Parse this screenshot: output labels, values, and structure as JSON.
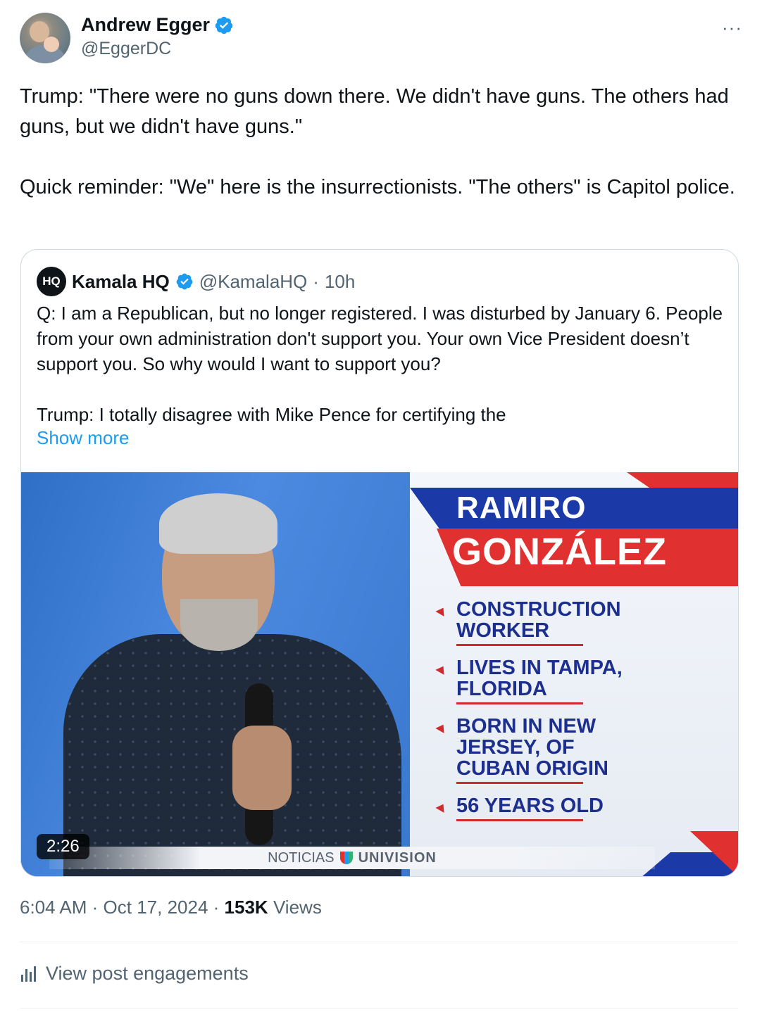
{
  "author": {
    "display_name": "Andrew Egger",
    "handle": "@EggerDC",
    "verified": true
  },
  "more_menu": "···",
  "tweet": {
    "text": "Trump: \"There were no guns down there. We didn't have guns. The others had guns, but we didn't have guns.\"\n\nQuick reminder: \"We\" here is the insurrectionists. \"The others\" is Capitol police."
  },
  "quote": {
    "logo_text": "HQ",
    "display_name": "Kamala HQ",
    "handle": "@KamalaHQ",
    "separator": "·",
    "time": "10h",
    "text": "Q: I am a Republican, but no longer registered. I was disturbed by January 6. People from your own administration don't support you. Your own Vice President doesn’t support you. So why would I want to support you?\n\nTrump: I totally disagree with Mike Pence for certifying the",
    "show_more": "Show more",
    "video": {
      "duration": "2:26",
      "overlay_first_name": "RAMIRO",
      "overlay_last_name": "GONZÁLEZ",
      "facts": [
        "CONSTRUCTION WORKER",
        "LIVES IN TAMPA, FLORIDA",
        "BORN IN NEW JERSEY, OF CUBAN ORIGIN",
        "56 YEARS OLD"
      ],
      "ticker_left": "NOTICIAS",
      "ticker_right": "UNIVISION"
    }
  },
  "meta": {
    "time": "6:04 AM",
    "date": "Oct 17, 2024",
    "views_count": "153K",
    "views_label": "Views"
  },
  "engagements_label": "View post engagements",
  "colors": {
    "link": "#1d9bf0",
    "secondary_text": "#536471",
    "verified_badge": "#1d9bf0"
  }
}
